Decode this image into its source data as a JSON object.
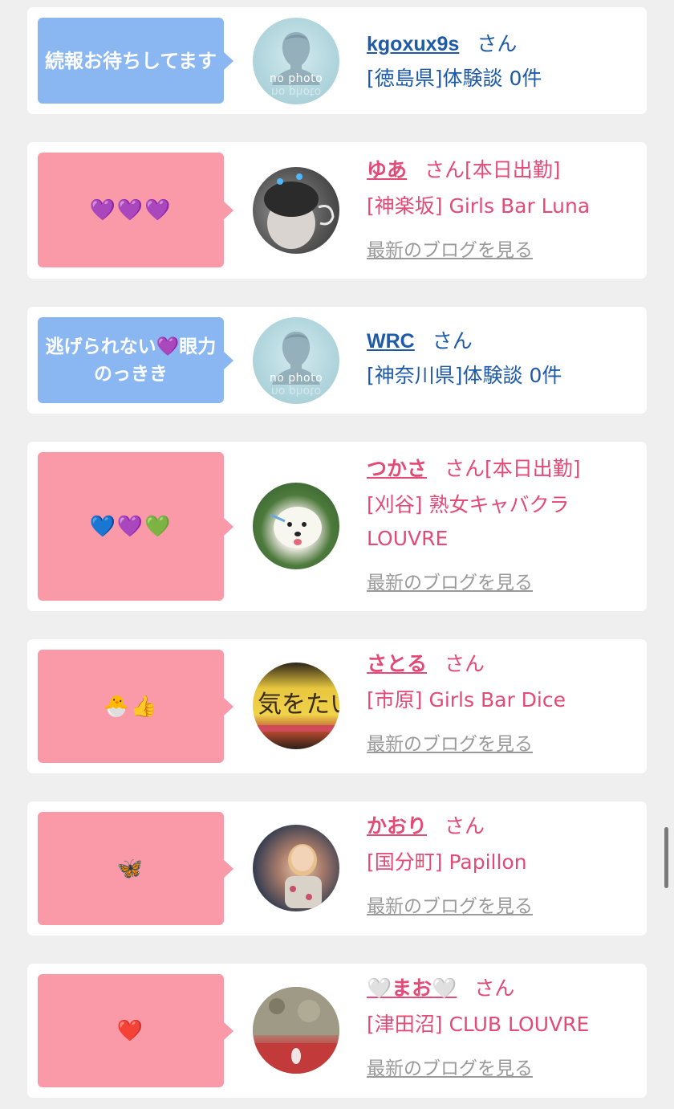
{
  "colors": {
    "page_bg": "#efefef",
    "card_bg": "#ffffff",
    "bubble_blue": "#8ab7f2",
    "bubble_pink": "#fa99a8",
    "link_blue": "#1e5aa8",
    "link_pink": "#e34a76",
    "blog_link_gray": "#9a9a9a"
  },
  "entries": [
    {
      "bubble": "続報お待ちしてます",
      "avatar_text": "no photo",
      "name": "kgoxux9s",
      "san": "さん",
      "status": "",
      "sub": "[徳島県]体験談 0件"
    },
    {
      "bubble": "💜💜💜",
      "name": "ゆあ",
      "san": "さん",
      "status": "[本日出勤]",
      "sub": "[神楽坂] Girls Bar Luna",
      "blog_link": "最新のブログを見る"
    },
    {
      "bubble": "逃げられない💜眼力のっきき",
      "avatar_text": "no photo",
      "name": "WRC",
      "san": "さん",
      "status": "",
      "sub": "[神奈川県]体験談 0件"
    },
    {
      "bubble": "💙💜💚",
      "name": "つかさ",
      "san": "さん",
      "status": "[本日出勤]",
      "sub_line1": "[刈谷] 熟女キャバクラ",
      "sub_line2": "LOUVRE",
      "blog_link": "最新のブログを見る"
    },
    {
      "bubble": "🐣👍",
      "name": "さとる",
      "san": "さん",
      "status": "",
      "sub": "[市原] Girls Bar Dice",
      "blog_link": "最新のブログを見る"
    },
    {
      "bubble": "🦋",
      "name": "かおり",
      "san": "さん",
      "status": "",
      "sub": "[国分町] Papillon",
      "blog_link": "最新のブログを見る"
    },
    {
      "bubble": "❤️",
      "name": "🤍まお🤍",
      "san": "さん",
      "status": "",
      "sub": "[津田沼] CLUB LOUVRE",
      "blog_link": "最新のブログを見る"
    }
  ]
}
